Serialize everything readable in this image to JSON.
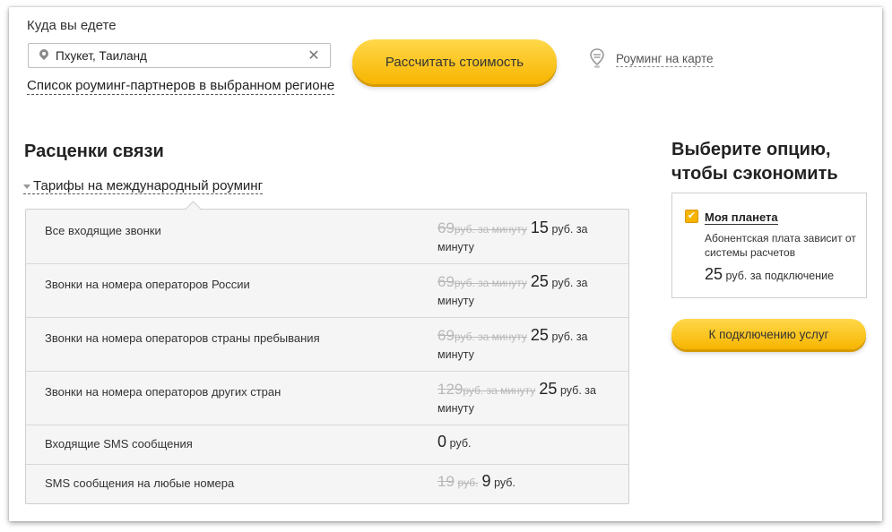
{
  "destination": {
    "label": "Куда вы едете",
    "value": "Пхукет, Таиланд",
    "partners_link": "Список роуминг-партнеров в выбранном регионе"
  },
  "calc_button": "Рассчитать стоимость",
  "map_link": "Роуминг на карте",
  "rates": {
    "title": "Расценки связи",
    "tab": "Тарифы на международный роуминг",
    "rows": [
      {
        "label": "Все входящие звонки",
        "old": "69",
        "old_unit": "руб. за минуту",
        "new": "15",
        "new_unit": "руб. за минуту"
      },
      {
        "label": "Звонки на номера операторов России",
        "old": "69",
        "old_unit": "руб. за минуту",
        "new": "25",
        "new_unit": "руб. за минуту"
      },
      {
        "label": "Звонки на номера операторов страны пребывания",
        "old": "69",
        "old_unit": "руб. за минуту",
        "new": "25",
        "new_unit": "руб. за минуту"
      },
      {
        "label": "Звонки на номера операторов других стран",
        "old": "129",
        "old_unit": "руб. за минуту",
        "new": "25",
        "new_unit": "руб. за минуту"
      },
      {
        "label": "Входящие SMS сообщения",
        "old": "",
        "old_unit": "",
        "new": "0",
        "new_unit": "руб."
      },
      {
        "label": "SMS сообщения на любые номера",
        "old": "19",
        "old_unit": "руб.",
        "new": "9",
        "new_unit": "руб."
      }
    ]
  },
  "offer": {
    "title_line1": "Выберите опцию,",
    "title_line2": "чтобы сэкономить",
    "option_name": "Моя планета",
    "option_desc": "Абонентская плата зависит от системы расчетов",
    "option_price": "25",
    "option_price_unit": "руб. за подключение",
    "connect_button": "К подключению услуг"
  },
  "colors": {
    "accent": "#f7b500",
    "accent_light": "#ffd84a"
  }
}
